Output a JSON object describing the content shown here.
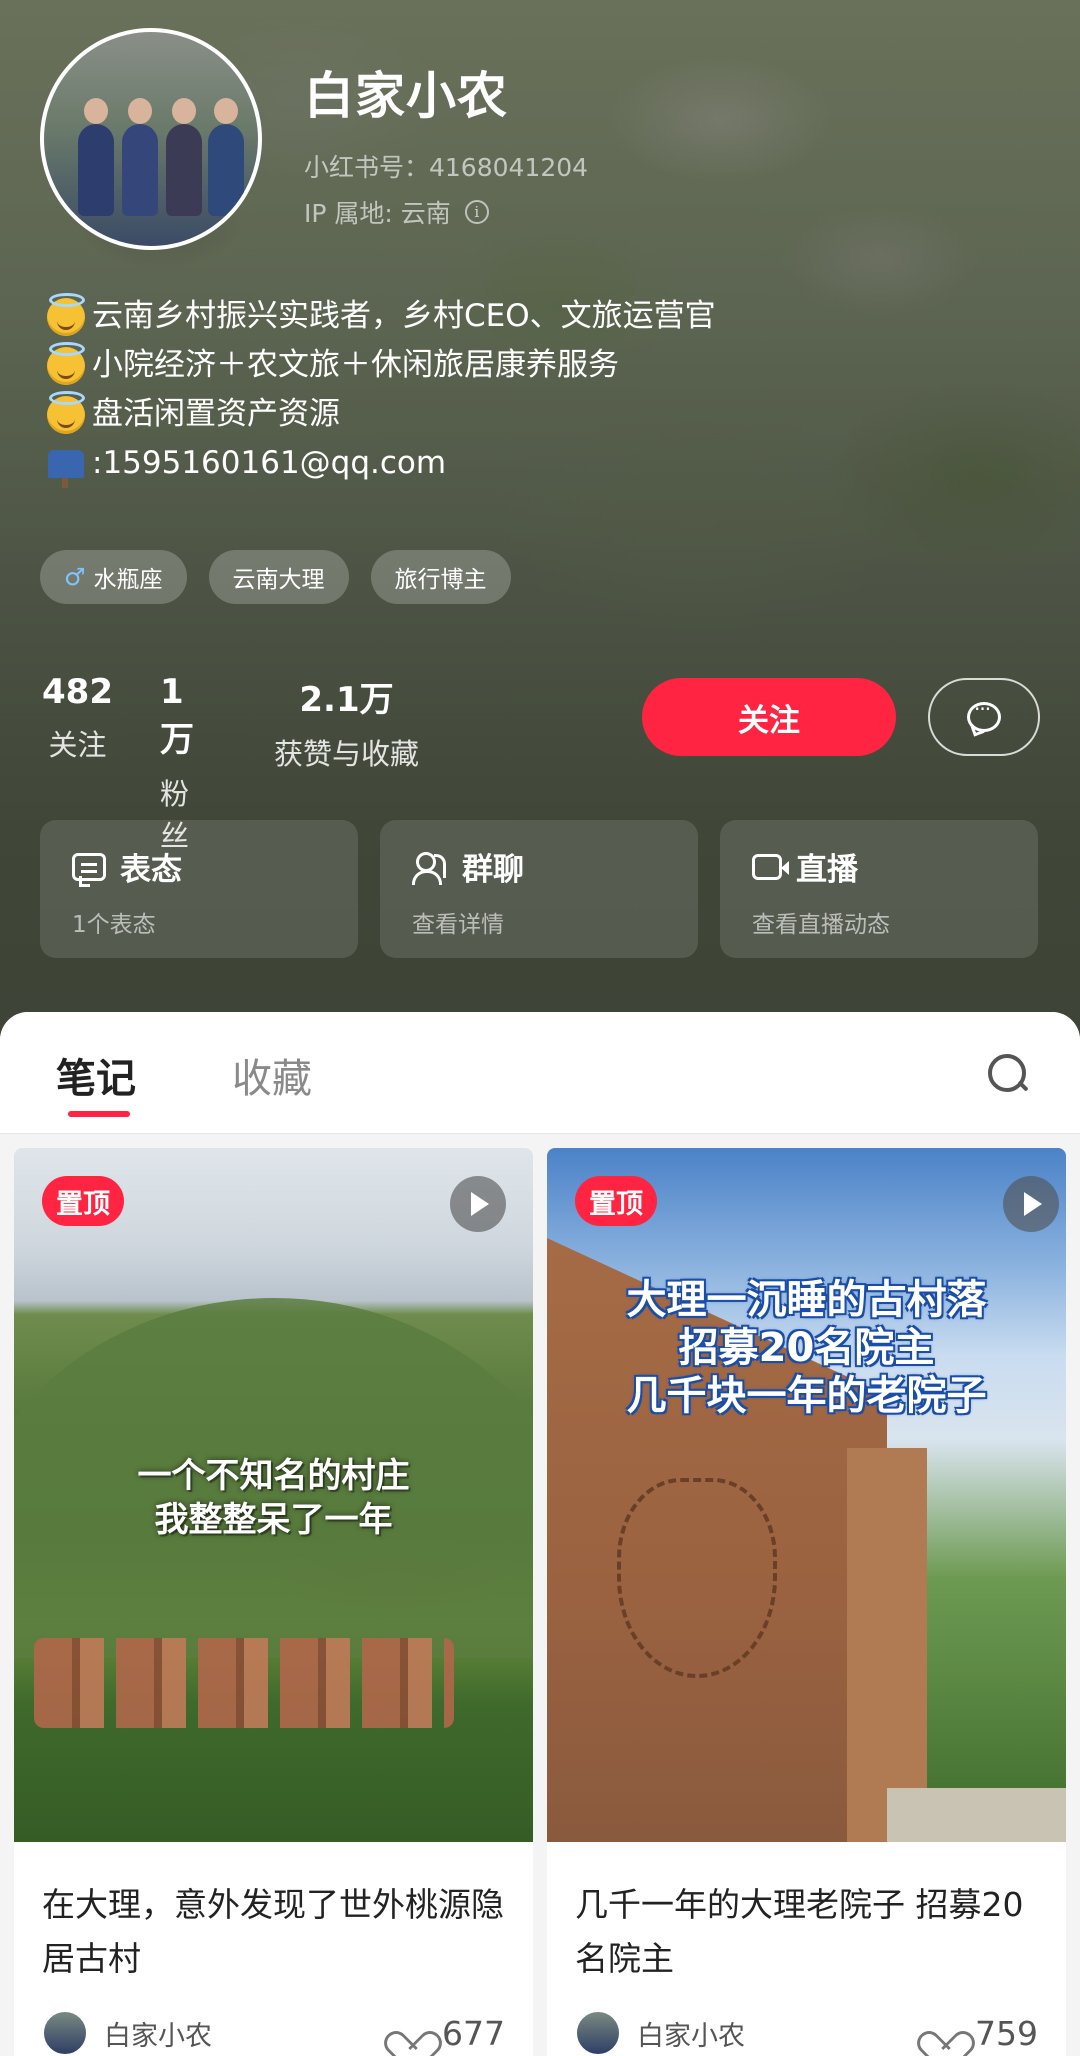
{
  "profile": {
    "name": "白家小农",
    "redbook_id": "小红书号：4168041204",
    "ip_location": "IP 属地: 云南",
    "bio": [
      {
        "icon": "angel-smile-emoji",
        "text": "云南乡村振兴实践者，乡村CEO、文旅运营官"
      },
      {
        "icon": "angel-smile-emoji",
        "text": "小院经济＋农文旅＋休闲旅居康养服务"
      },
      {
        "icon": "angel-smile-emoji",
        "text": "盘活闲置资产资源"
      },
      {
        "icon": "mailbox-emoji",
        "text": ":1595160161@qq.com"
      }
    ],
    "tags": [
      "水瓶座",
      "云南大理",
      "旅行博主"
    ]
  },
  "stats": [
    {
      "value": "482",
      "label": "关注"
    },
    {
      "value": "1万",
      "label": "粉丝"
    },
    {
      "value": "2.1万",
      "label": "获赞与收藏"
    }
  ],
  "actions": {
    "follow_label": "关注"
  },
  "cards": [
    {
      "icon": "comment-icon",
      "title": "表态",
      "subtitle": "1个表态"
    },
    {
      "icon": "group-icon",
      "title": "群聊",
      "subtitle": "查看详情"
    },
    {
      "icon": "live-icon",
      "title": "直播",
      "subtitle": "查看直播动态"
    }
  ],
  "tabs": [
    {
      "label": "笔记",
      "active": true
    },
    {
      "label": "收藏",
      "active": false
    }
  ],
  "notes": [
    {
      "badge": "置顶",
      "cover_text": [
        "一个不知名的村庄",
        "我整整呆了一年"
      ],
      "title": "在大理，意外发现了世外桃源隐居古村",
      "author": "白家小农",
      "likes": "677"
    },
    {
      "badge": "置顶",
      "cover_text": [
        "大理一沉睡的古村落",
        "招募20名院主",
        "几千块一年的老院子"
      ],
      "title": "几千一年的大理老院子 招募20名院主",
      "author": "白家小农",
      "likes": "759"
    }
  ],
  "colors": {
    "accent": "#ff2442",
    "header_bg": "#4d5544"
  }
}
